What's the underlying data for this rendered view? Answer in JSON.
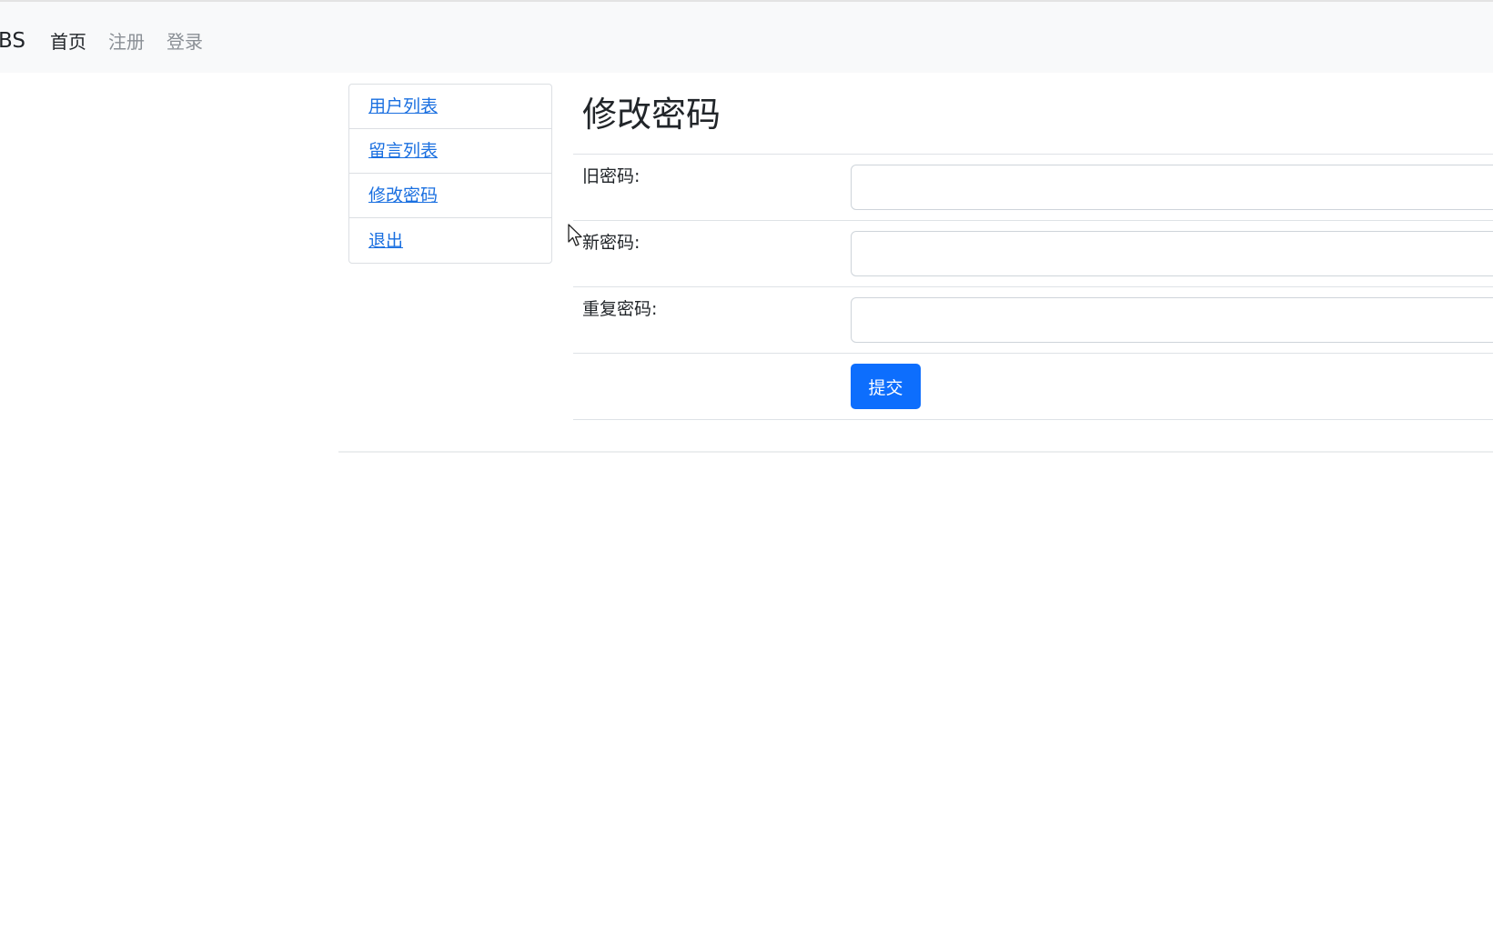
{
  "navbar": {
    "brand": "BS",
    "links": [
      {
        "label": "首页",
        "active": true
      },
      {
        "label": "注册",
        "active": false
      },
      {
        "label": "登录",
        "active": false
      }
    ]
  },
  "sidebar": {
    "items": [
      {
        "label": "用户列表"
      },
      {
        "label": "留言列表"
      },
      {
        "label": "修改密码"
      },
      {
        "label": "退出"
      }
    ]
  },
  "main": {
    "title": "修改密码",
    "fields": [
      {
        "label": "旧密码:",
        "value": "",
        "placeholder": ""
      },
      {
        "label": "新密码:",
        "value": "",
        "placeholder": ""
      },
      {
        "label": "重复密码:",
        "value": "",
        "placeholder": ""
      }
    ],
    "submit_label": "提交"
  },
  "colors": {
    "primary": "#0d6efd",
    "link": "#1a6fe0",
    "navbar_bg": "#f8f9fa",
    "muted_text": "#8a8f95"
  },
  "icons": {
    "cursor": "mouse-pointer-icon"
  }
}
